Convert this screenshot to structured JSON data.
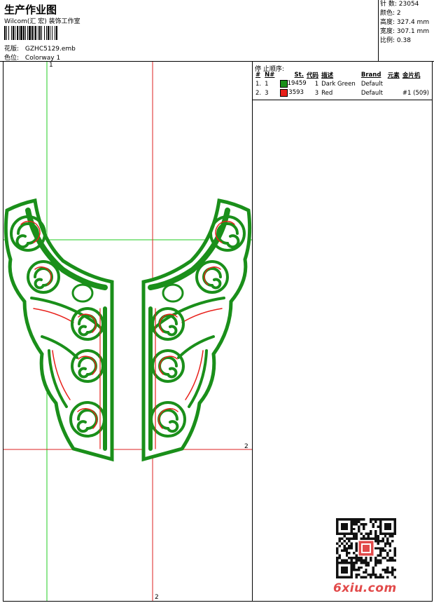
{
  "header": {
    "title": "生产作业图",
    "company": "Wilcom(汇 宏) 装饰工作室",
    "design_label": "花版:",
    "design_file": "GZHC5129.emb",
    "colorway_label": "色位:",
    "colorway_name": "Colorway 1"
  },
  "stats": [
    {
      "label": "针 数:",
      "value": "23054"
    },
    {
      "label": "颜色:",
      "value": "2"
    },
    {
      "label": "高度:",
      "value": "327.4 mm"
    },
    {
      "label": "宽度:",
      "value": "307.1 mm"
    },
    {
      "label": "比例:",
      "value": "0.38"
    }
  ],
  "stop_sequence": {
    "title": "停 止顺序:",
    "headers": {
      "hash": "#",
      "num": "N#",
      "stitches": "St.",
      "code": "代码",
      "description": "描述",
      "brand": "Brand",
      "element": "元素",
      "sequin": "金片机"
    },
    "rows": [
      {
        "hash": "1.",
        "num": "1",
        "color": "#1a8f1a",
        "stitches": "19459",
        "code": "1",
        "description": "Dark Green",
        "brand": "Default",
        "element": "",
        "sequin": ""
      },
      {
        "hash": "2.",
        "num": "3",
        "color": "#e8201a",
        "stitches": "3593",
        "code": "3",
        "description": "Red",
        "brand": "Default",
        "element": "",
        "sequin": "#1 (509)"
      }
    ]
  },
  "guides": {
    "top_label": "1",
    "right_label": "2",
    "bottom_label": "2",
    "green": "#22cc22",
    "red": "#dd2222"
  },
  "embroidery": {
    "thread_green": "#1a8f1a",
    "thread_red": "#e8201a"
  },
  "watermark": "6xiu.com"
}
